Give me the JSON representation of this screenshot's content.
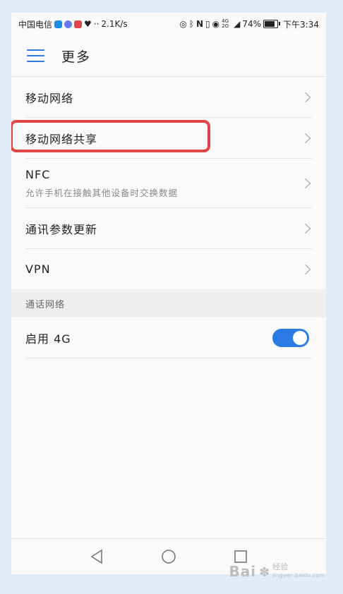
{
  "status_bar": {
    "carrier": "中国电信",
    "speed": "2.1K/s",
    "network": "4G 2G",
    "battery": "74%",
    "battery_level": 0.74,
    "time": "下午3:34"
  },
  "header": {
    "title": "更多"
  },
  "rows": [
    {
      "label": "移动网络"
    },
    {
      "label": "移动网络共享"
    },
    {
      "label": "NFC",
      "sub": "允许手机在接触其他设备时交换数据"
    },
    {
      "label": "通讯参数更新"
    },
    {
      "label": "VPN"
    }
  ],
  "section": {
    "title": "通话网络",
    "toggle_row": {
      "label": "启用 4G",
      "enabled": true
    }
  },
  "colors": {
    "accent": "#2c7be5",
    "highlight": "#e14545"
  },
  "watermark": {
    "logo": "Bai",
    "text1": "经验",
    "text2": "jingyan.baidu.com"
  }
}
